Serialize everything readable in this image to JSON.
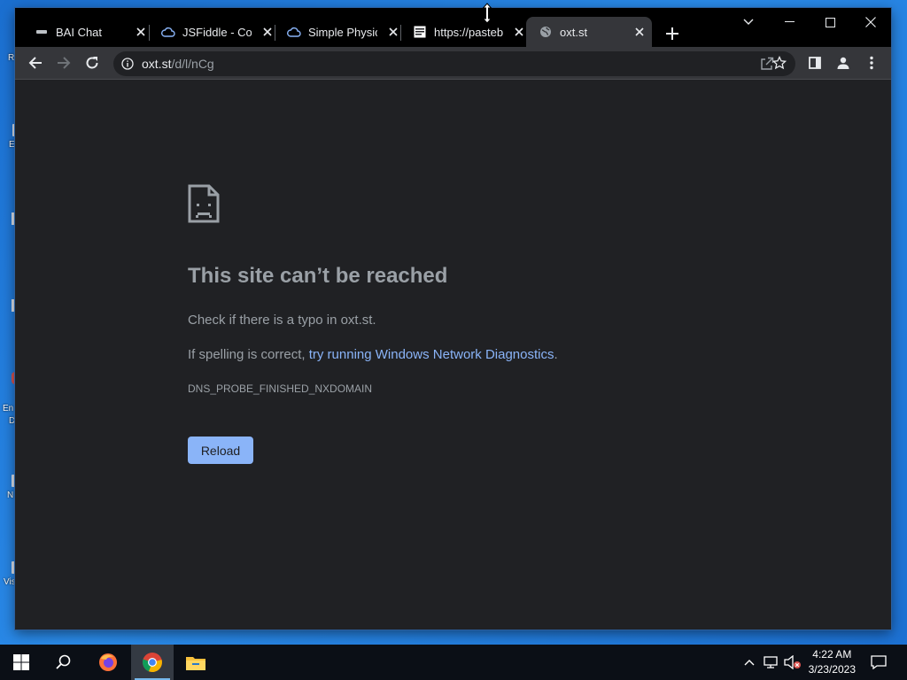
{
  "desktop": {
    "icons": [
      {
        "label": "R"
      },
      {
        "label": "E"
      },
      {
        "label": "En"
      },
      {
        "label": "D"
      },
      {
        "label": "N"
      },
      {
        "label": "Vis"
      }
    ]
  },
  "tabs": [
    {
      "title": "BAI Chat",
      "favicon": "bai-favicon",
      "active": false
    },
    {
      "title": "JSFiddle - Code Playground",
      "favicon": "jsfiddle-cloud-icon",
      "active": false
    },
    {
      "title": "Simple Physics",
      "favicon": "jsfiddle-cloud-icon",
      "active": false
    },
    {
      "title": "https://pastebin",
      "favicon": "pastebin-icon",
      "active": false
    },
    {
      "title": "oxt.st",
      "favicon": "globe-icon",
      "active": true
    }
  ],
  "omnibox": {
    "host": "oxt.st",
    "path": "/d/l/nCg"
  },
  "error_page": {
    "title": "This site can’t be reached",
    "line1": "Check if there is a typo in oxt.st.",
    "line2_prefix": "If spelling is correct, ",
    "line2_link": "try running Windows Network Diagnostics",
    "line2_suffix": ".",
    "code": "DNS_PROBE_FINISHED_NXDOMAIN",
    "reload_label": "Reload"
  },
  "taskbar": {
    "apps": [
      "start-icon",
      "search-icon",
      "firefox-icon",
      "chrome-icon",
      "file-explorer-icon"
    ],
    "clock_time": "4:22 AM",
    "clock_date": "3/23/2023"
  },
  "colors": {
    "accent": "#8ab4f8",
    "page_bg": "#202124",
    "text_muted": "#9aa0a6"
  }
}
